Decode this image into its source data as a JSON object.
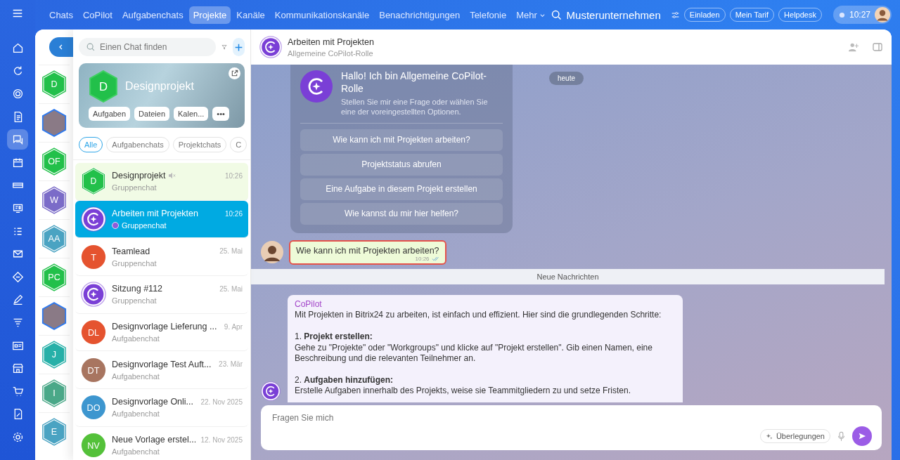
{
  "topnav": {
    "tabs": [
      {
        "label": "Chats",
        "selected": false
      },
      {
        "label": "CoPilot",
        "selected": false
      },
      {
        "label": "Aufgabenchats",
        "selected": false
      },
      {
        "label": "Projekte",
        "selected": true
      },
      {
        "label": "Kanäle",
        "selected": false
      },
      {
        "label": "Kommunikationskanäle",
        "selected": false
      },
      {
        "label": "Benachrichtigungen",
        "selected": false
      },
      {
        "label": "Telefonie",
        "selected": false
      }
    ],
    "more": "Mehr",
    "company": "Musterunternehmen",
    "buttons": [
      "Einladen",
      "Mein Tarif",
      "Helpdesk"
    ],
    "time": "10:27"
  },
  "rail": [
    {
      "kind": "home",
      "selected": false
    },
    {
      "kind": "refresh",
      "selected": false
    },
    {
      "kind": "target",
      "selected": false
    },
    {
      "kind": "document",
      "selected": false
    },
    {
      "kind": "chat",
      "selected": true
    },
    {
      "kind": "calendar",
      "selected": false
    },
    {
      "kind": "card",
      "selected": false
    },
    {
      "kind": "board",
      "selected": false
    },
    {
      "kind": "tasks",
      "selected": false
    },
    {
      "kind": "mail",
      "selected": false
    },
    {
      "kind": "diamond",
      "selected": false
    },
    {
      "kind": "pen",
      "selected": false
    },
    {
      "kind": "funnel",
      "selected": false
    },
    {
      "kind": "idcard",
      "selected": false
    },
    {
      "kind": "store",
      "selected": false
    },
    {
      "kind": "cart",
      "selected": false
    },
    {
      "kind": "docpen",
      "selected": false
    },
    {
      "kind": "gear",
      "selected": false
    }
  ],
  "recent": [
    {
      "kind": "hex",
      "initials": "D",
      "color": "#22c04a"
    },
    {
      "kind": "photo"
    },
    {
      "kind": "hex",
      "initials": "OF",
      "color": "#22c04a"
    },
    {
      "kind": "hex",
      "initials": "W",
      "color": "#7b6cc8"
    },
    {
      "kind": "hex",
      "initials": "AA",
      "color": "#4aa3c2"
    },
    {
      "kind": "hex",
      "initials": "PC",
      "color": "#22c04a"
    },
    {
      "kind": "photo"
    },
    {
      "kind": "hex",
      "initials": "J",
      "color": "#26b0a8"
    },
    {
      "kind": "hex",
      "initials": "I",
      "color": "#4aa888"
    },
    {
      "kind": "hex",
      "initials": "E",
      "color": "#4aa3c2"
    }
  ],
  "list": {
    "search": {
      "placeholder": "Einen Chat finden"
    },
    "project": {
      "initials": "D",
      "title": "Designprojekt",
      "actions": [
        "Aufgaben",
        "Dateien",
        "Kalen...",
        "•••"
      ]
    },
    "filters": [
      {
        "label": "Alle",
        "selected": true
      },
      {
        "label": "Aufgabenchats",
        "selected": false
      },
      {
        "label": "Projektchats",
        "selected": false
      },
      {
        "label": "C",
        "selected": false
      }
    ],
    "chats": [
      {
        "kind": "hex",
        "initials": "D",
        "color": "#22c04a",
        "title": "Designprojekt",
        "time": "10:26",
        "subtitle": "Gruppenchat",
        "muted": true,
        "selected": false,
        "highlighted": true
      },
      {
        "kind": "copilot",
        "color": "#7a3fd6",
        "title": "Arbeiten mit Projekten",
        "time": "10:26",
        "subtitle": "Gruppenchat",
        "muted": false,
        "selected": true,
        "highlighted": false
      },
      {
        "kind": "circle",
        "initials": "T",
        "color": "#e5532f",
        "title": "Teamlead",
        "time": "25. Mai",
        "subtitle": "Gruppenchat",
        "muted": false,
        "selected": false,
        "highlighted": false
      },
      {
        "kind": "copilot",
        "color": "#7a3fd6",
        "title": "Sitzung #112",
        "time": "25. Mai",
        "subtitle": "Gruppenchat",
        "muted": false,
        "selected": false,
        "highlighted": false
      },
      {
        "kind": "circle",
        "initials": "DL",
        "color": "#e5532f",
        "title": "Designvorlage Lieferung ...",
        "time": "9. Apr",
        "subtitle": "Aufgabenchat",
        "muted": false,
        "selected": false,
        "highlighted": false
      },
      {
        "kind": "circle",
        "initials": "DT",
        "color": "#a87560",
        "title": "Designvorlage Test Auft...",
        "time": "23. Mär",
        "subtitle": "Aufgabenchat",
        "muted": false,
        "selected": false,
        "highlighted": false
      },
      {
        "kind": "circle",
        "initials": "DO",
        "color": "#3d96cf",
        "title": "Designvorlage Onli...",
        "time": "22. Nov 2025",
        "subtitle": "Aufgabenchat",
        "muted": false,
        "selected": false,
        "highlighted": false
      },
      {
        "kind": "circle",
        "initials": "NV",
        "color": "#54c13a",
        "title": "Neue Vorlage erstel...",
        "time": "12. Nov 2025",
        "subtitle": "Aufgabenchat",
        "muted": false,
        "selected": false,
        "highlighted": false
      }
    ]
  },
  "chat": {
    "title": "Arbeiten mit Projekten",
    "subtitle": "Allgemeine CoPilot-Rolle",
    "welcome": {
      "title": "Hallo! Ich bin Allgemeine CoPilot-Rolle",
      "text": "Stellen Sie mir eine Frage oder wählen Sie eine der voreingestellten Optionen.",
      "options": [
        "Wie kann ich mit Projekten arbeiten?",
        "Projektstatus abrufen",
        "Eine Aufgabe in diesem Projekt erstellen",
        "Wie kannst du mir hier helfen?"
      ]
    },
    "date": "heute",
    "user_message": {
      "text": "Wie kann ich mit Projekten arbeiten?",
      "time": "10:26",
      "read": true
    },
    "divider": "Neue Nachrichten",
    "reply": {
      "author": "CoPilot",
      "paragraphs": [
        "Mit Projekten in Bitrix24 zu arbeiten, ist einfach und effizient. Hier sind die grundlegenden Schritte:",
        "1. **Projekt erstellen:**\nGehe zu \"Projekte\" oder \"Workgroups\" und klicke auf \"Projekt erstellen\". Gib einen Namen, eine Beschreibung und die relevanten Teilnehmer an.",
        "2. **Aufgaben hinzufügen:**\nErstelle Aufgaben innerhalb des Projekts, weise sie Teammitgliedern zu und setze Fristen."
      ]
    },
    "input": {
      "placeholder": "Fragen Sie mich",
      "reasoning": "Überlegungen"
    }
  }
}
